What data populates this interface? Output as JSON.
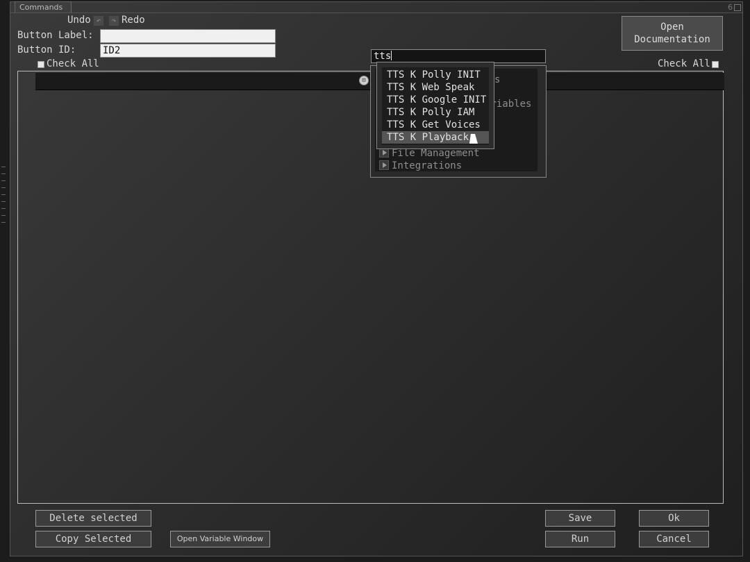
{
  "window": {
    "title": "Commands",
    "corner_number": "6"
  },
  "toolbar": {
    "undo_label": "Undo",
    "redo_label": "Redo"
  },
  "form": {
    "button_label_label": "Button Label:",
    "button_label_value": "",
    "button_id_label": "Button ID:",
    "button_id_value": "ID2"
  },
  "check_all_left": "Check All",
  "check_all_right": "Check All",
  "search": {
    "value": "tts"
  },
  "docs_button": {
    "line1": "Open",
    "line2": "Documentation"
  },
  "categories": {
    "partial_1": "s",
    "partial_2": "ariables",
    "file_management": "File Management",
    "integrations": "Integrations"
  },
  "dropdown_items": [
    "TTS K Polly INIT",
    "TTS K Web Speak",
    "TTS K Google INIT",
    "TTS K Polly IAM",
    "TTS K Get Voices",
    "TTS K Playback"
  ],
  "highlighted_item_index": 5,
  "footer": {
    "delete_selected": "Delete selected",
    "copy_selected": "Copy Selected",
    "open_variable_window": "Open Variable Window",
    "save": "Save",
    "run": "Run",
    "ok": "Ok",
    "cancel": "Cancel"
  }
}
